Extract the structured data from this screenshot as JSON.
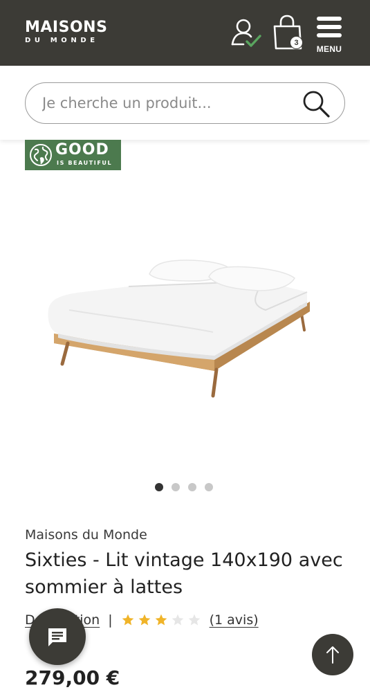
{
  "header": {
    "logo_main": "MAISONS",
    "logo_sub": "DU MONDE",
    "account_icon": "user-check-icon",
    "cart_icon": "shopping-bag-icon",
    "cart_count": "3",
    "menu_icon": "hamburger-icon",
    "menu_label": "MENU",
    "background_color": "#3c3b36"
  },
  "search": {
    "placeholder": "Je cherche un produit...",
    "value": "",
    "icon": "search-icon"
  },
  "badge": {
    "title": "GOOD",
    "subtitle": "IS BEAUTIFUL",
    "icon": "globe-icon",
    "color": "#4c7a4e"
  },
  "gallery": {
    "image_alt": "bed-product-image",
    "dot_count": 4,
    "active_index": 0
  },
  "product": {
    "brand": "Maisons du Monde",
    "title": "Sixties - Lit vintage 140x190 avec sommier à lattes",
    "description_link": "Description",
    "separator": "|",
    "rating": 3,
    "rating_max": 5,
    "star_color": "#f0b429",
    "reviews_link": "(1 avis)",
    "price": "279,00 €"
  },
  "floating": {
    "chat_icon": "chat-bubble-icon",
    "scroll_top_icon": "arrow-up-icon"
  }
}
